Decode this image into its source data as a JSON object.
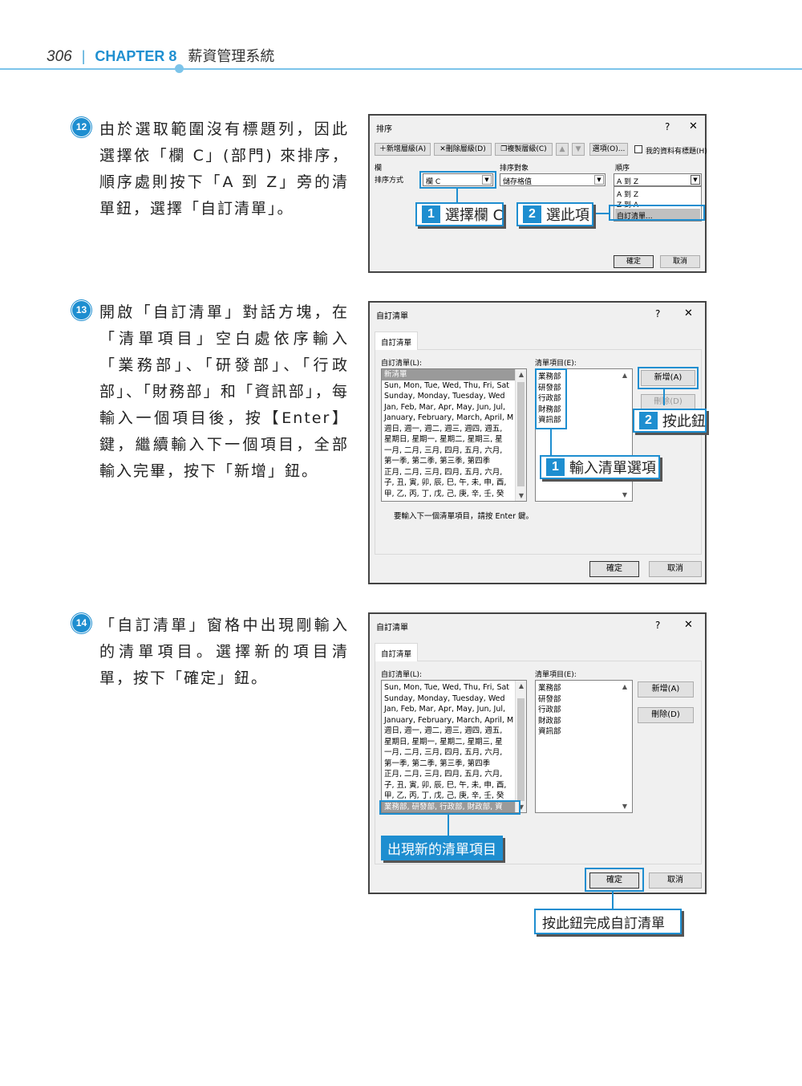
{
  "header": {
    "page_number": "306",
    "separator": "|",
    "chapter": "CHAPTER 8",
    "title": "薪資管理系統"
  },
  "steps": [
    {
      "num": "12",
      "text": "由於選取範圍沒有標題列，因此選擇依「欄 C」(部門) 來排序，順序處則按下「A 到 Z」旁的清單鈕，選擇「自訂清單」。"
    },
    {
      "num": "13",
      "text": "開啟「自訂清單」對話方塊，在「清單項目」空白處依序輸入「業務部」、「研發部」、「行政部」、「財務部」和「資訊部」，每輸入一個項目後，按【Enter】鍵，繼續輸入下一個項目，全部輸入完畢，按下「新增」鈕。"
    },
    {
      "num": "14",
      "text": "「自訂清單」窗格中出現剛輸入的清單項目。選擇新的項目清單，按下「確定」鈕。"
    }
  ],
  "dialog_sort": {
    "title": "排序",
    "help": "?",
    "close": "✕",
    "add_level": "新增層級(A)",
    "delete_level": "刪除層級(D)",
    "copy_level": "複製層級(C)",
    "up": "▲",
    "down": "▼",
    "options": "選項(O)...",
    "has_headers": "我的資料有標題(H)",
    "col_header": "欄",
    "sort_on_header": "排序對象",
    "order_header": "順序",
    "row_label": "排序方式",
    "column_value": "欄 C",
    "sort_on_value": "儲存格值",
    "order_value": "A 到 Z",
    "order_options": [
      "A 到 Z",
      "Z 到 A",
      "自訂清單..."
    ],
    "ok": "確定",
    "cancel": "取消",
    "callout1_num": "1",
    "callout1_text": "選擇欄 C",
    "callout2_num": "2",
    "callout2_text": "選此項"
  },
  "dialog_custom1": {
    "title": "自訂清單",
    "help": "?",
    "close": "✕",
    "tab": "自訂清單",
    "lists_label": "自訂清單(L):",
    "entries_label": "清單項目(E):",
    "lists": [
      "新清單",
      "Sun, Mon, Tue, Wed, Thu, Fri, Sat",
      "Sunday, Monday, Tuesday, Wed",
      "Jan, Feb, Mar, Apr, May, Jun, Jul,",
      "January, February, March, April, M",
      "週日, 週一, 週二, 週三, 週四, 週五,",
      "星期日, 星期一, 星期二, 星期三, 星",
      "一月, 二月, 三月, 四月, 五月, 六月,",
      "第一季, 第二季, 第三季, 第四季",
      "正月, 二月, 三月, 四月, 五月, 六月,",
      "子, 丑, 寅, 卯, 辰, 巳, 午, 未, 申, 酉,",
      "甲, 乙, 丙, 丁, 戊, 己, 庚, 辛, 壬, 癸"
    ],
    "entries": [
      "業務部",
      "研發部",
      "行政部",
      "財務部",
      "資訊部"
    ],
    "add": "新增(A)",
    "delete": "刪除(D)",
    "hint": "要輸入下一個清單項目，請按 Enter 鍵。",
    "ok": "確定",
    "cancel": "取消",
    "callout1_num": "1",
    "callout1_text": "輸入清單選項",
    "callout2_num": "2",
    "callout2_text": "按此鈕"
  },
  "dialog_custom2": {
    "title": "自訂清單",
    "help": "?",
    "close": "✕",
    "tab": "自訂清單",
    "lists_label": "自訂清單(L):",
    "entries_label": "清單項目(E):",
    "lists": [
      "Sun, Mon, Tue, Wed, Thu, Fri, Sat",
      "Sunday, Monday, Tuesday, Wed",
      "Jan, Feb, Mar, Apr, May, Jun, Jul,",
      "January, February, March, April, M",
      "週日, 週一, 週二, 週三, 週四, 週五,",
      "星期日, 星期一, 星期二, 星期三, 星",
      "一月, 二月, 三月, 四月, 五月, 六月,",
      "第一季, 第二季, 第三季, 第四季",
      "正月, 二月, 三月, 四月, 五月, 六月,",
      "子, 丑, 寅, 卯, 辰, 巳, 午, 未, 申, 酉,",
      "甲, 乙, 丙, 丁, 戊, 己, 庚, 辛, 壬, 癸",
      "業務部, 研發部, 行政部, 財政部, 資"
    ],
    "entries": [
      "業務部",
      "研發部",
      "行政部",
      "財政部",
      "資訊部"
    ],
    "add": "新增(A)",
    "delete": "刪除(D)",
    "ok": "確定",
    "cancel": "取消",
    "callout_new": "出現新的清單項目",
    "callout_ok": "按此鈕完成自訂清單"
  }
}
